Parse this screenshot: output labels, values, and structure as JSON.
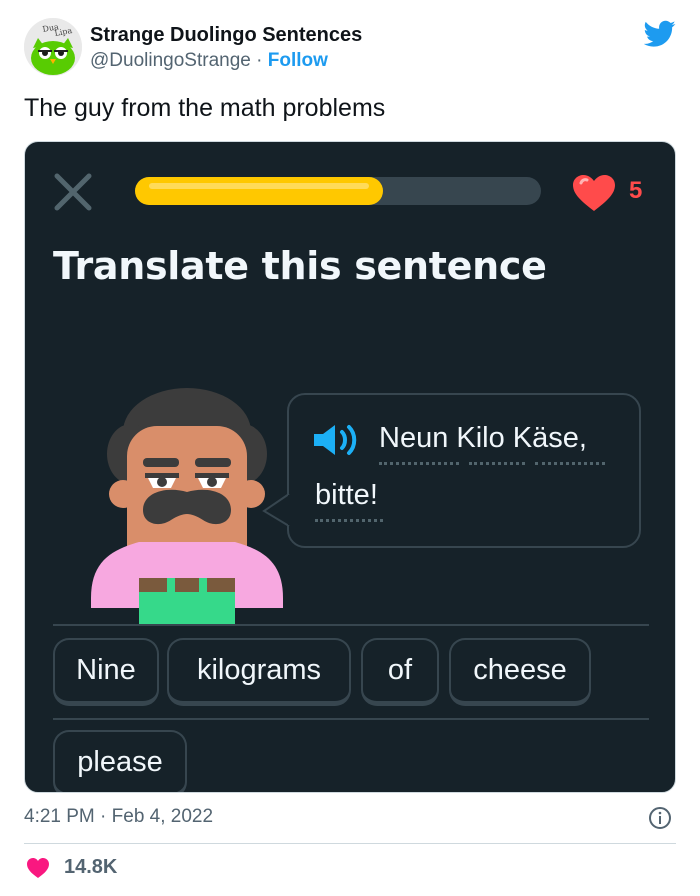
{
  "tweet": {
    "author_name": "Strange Duolingo Sentences",
    "author_handle": "@DuolingoStrange",
    "separator": "·",
    "follow_label": "Follow",
    "avatar_text": "Dua Lipa",
    "text": "The guy from the math problems",
    "timestamp": "4:21 PM · Feb 4, 2022",
    "likes": "14.8K"
  },
  "duolingo": {
    "progress": 0.61,
    "hearts": "5",
    "heading": "Translate this sentence",
    "sentence_line1": "Neun Kilo Käse,",
    "sentence_line2": "bitte!",
    "answer_words": [
      "Nine",
      "kilograms",
      "of",
      "cheese"
    ],
    "extra_word": "please"
  },
  "colors": {
    "twitter_blue": "#1d9bf0",
    "like_red": "#f91880",
    "duo_bg": "#162229",
    "progress_yellow": "#ffc800",
    "heart_red": "#ff4b4b",
    "speaker_blue": "#1cb0f6",
    "chip_border": "#37464f"
  },
  "icons": [
    "twitter-bird-icon",
    "close-icon",
    "heart-icon",
    "speaker-icon",
    "info-icon",
    "like-heart-icon"
  ]
}
